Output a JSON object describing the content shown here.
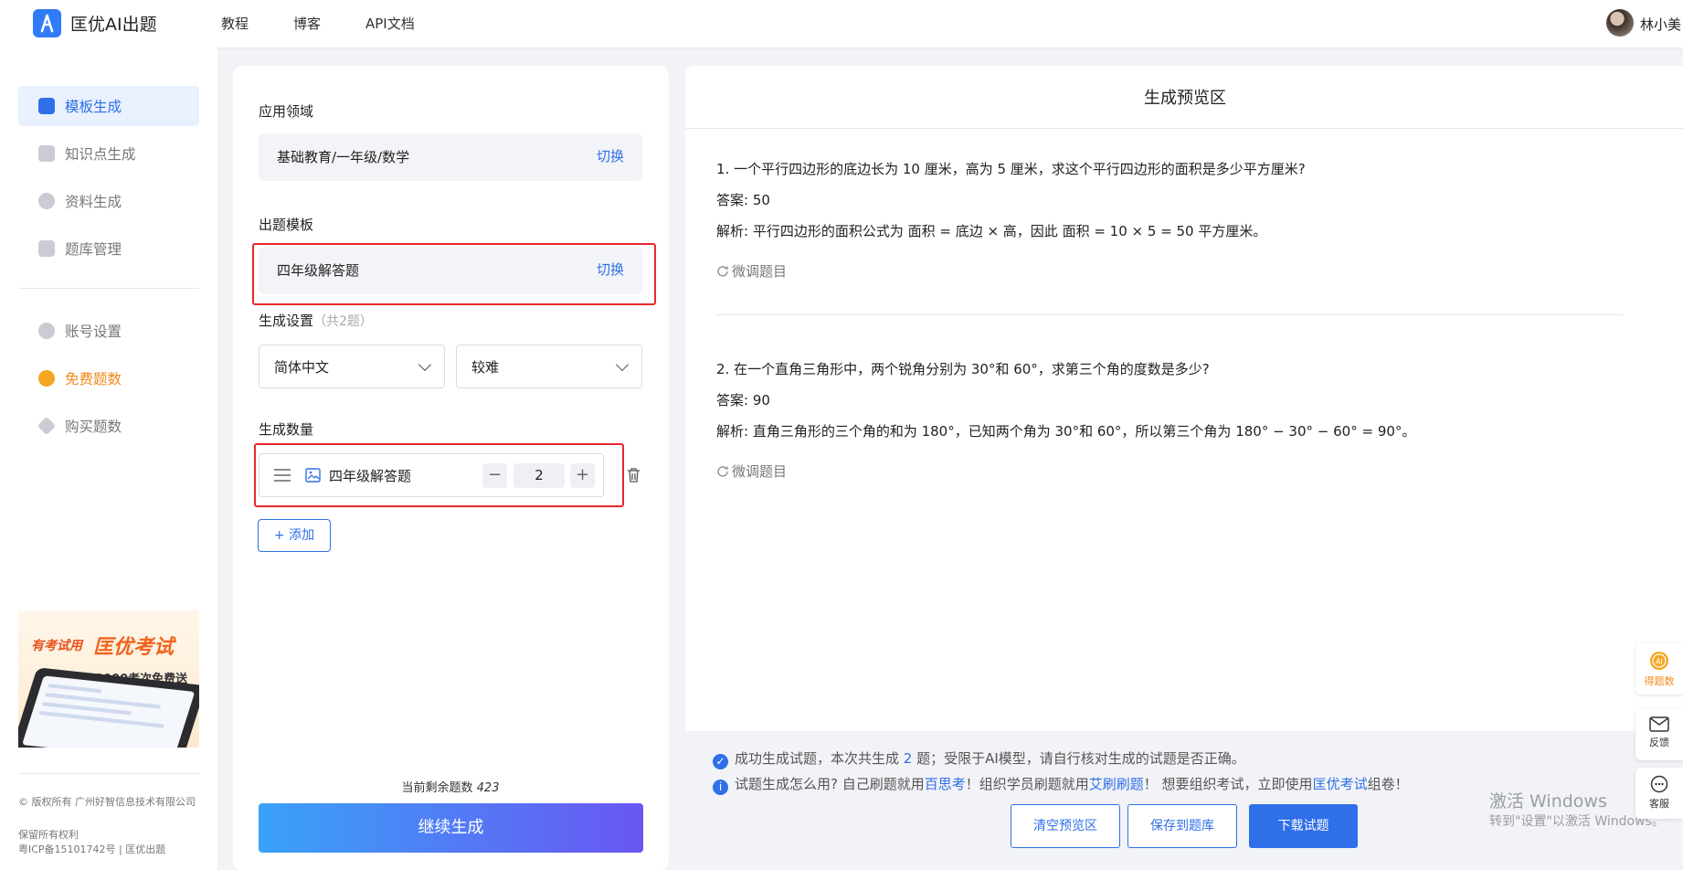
{
  "header": {
    "brand": "匡优AI出题",
    "nav": [
      "教程",
      "博客",
      "API文档"
    ],
    "username": "林小美"
  },
  "sidebar": {
    "items": [
      {
        "label": "模板生成",
        "icon": "template-icon",
        "active": true
      },
      {
        "label": "知识点生成",
        "icon": "knowledge-icon"
      },
      {
        "label": "资料生成",
        "icon": "material-icon"
      },
      {
        "label": "题库管理",
        "icon": "question-bank-icon"
      },
      {
        "label": "账号设置",
        "icon": "user-icon"
      },
      {
        "label": "免费题数",
        "icon": "ai-coin-icon",
        "highlight_color": "#f08a1c"
      },
      {
        "label": "购买题数",
        "icon": "diamond-icon"
      }
    ],
    "ad": {
      "tag": "有考试用",
      "brand": "匡优考试",
      "slogan": "3000考次免费送"
    },
    "footer": [
      "© 版权所有 广州好智信息技术有限公司",
      "保留所有权利",
      "粤ICP备15101742号 | 匡优出题"
    ]
  },
  "form": {
    "domain_label": "应用领域",
    "domain_value": "基础教育/一年级/数学",
    "switch_label": "切换",
    "template_label": "出题模板",
    "template_value": "四年级解答题",
    "settings_label": "生成设置",
    "settings_count": "（共2题）",
    "language": "简体中文",
    "difficulty": "较难",
    "quantity_label": "生成数量",
    "quantity_item": "四年级解答题",
    "quantity_value": "2",
    "add_label": "+ 添加",
    "remaining_label": "当前剩余题数",
    "remaining_value": "423",
    "generate_label": "继续生成"
  },
  "preview": {
    "title": "生成预览区",
    "tune_label": "微调题目",
    "questions": [
      {
        "question": "1. 一个平行四边形的底边长为 10 厘米，高为 5 厘米，求这个平行四边形的面积是多少平方厘米?",
        "answer": "答案: 50",
        "analysis": "解析: 平行四边形的面积公式为 面积 = 底边 × 高，因此 面积 = 10 × 5 = 50 平方厘米。"
      },
      {
        "question": "2. 在一个直角三角形中，两个锐角分别为 30°和 60°，求第三个角的度数是多少?",
        "answer": "答案: 90",
        "analysis": "解析: 直角三角形的三个角的和为 180°，已知两个角为 30°和 60°，所以第三个角为 180° − 30° − 60° = 90°。"
      }
    ],
    "notice1_a": "成功生成试题，本次共生成 ",
    "notice1_count": "2",
    "notice1_b": " 题；受限于AI模型，请自行核对生成的试题是否正确。",
    "notice2_a": "试题生成怎么用? 自己刷题就用",
    "notice2_link1": "百思考",
    "notice2_b": "！组织学员刷题就用",
    "notice2_link2": "艾刷刷题",
    "notice2_c": "！ 想要组织考试，立即使用",
    "notice2_link3": "匡优考试",
    "notice2_d": "组卷！",
    "buttons": {
      "clear": "清空预览区",
      "save": "保存到题库",
      "download": "下载试题"
    }
  },
  "float": [
    {
      "label": "得题数",
      "icon": "ai-coin-icon"
    },
    {
      "label": "反馈",
      "icon": "mail-icon"
    },
    {
      "label": "客服",
      "icon": "chat-icon"
    }
  ],
  "watermark": {
    "line1": "激活 Windows",
    "line2": "转到\"设置\"以激活 Windows。"
  }
}
